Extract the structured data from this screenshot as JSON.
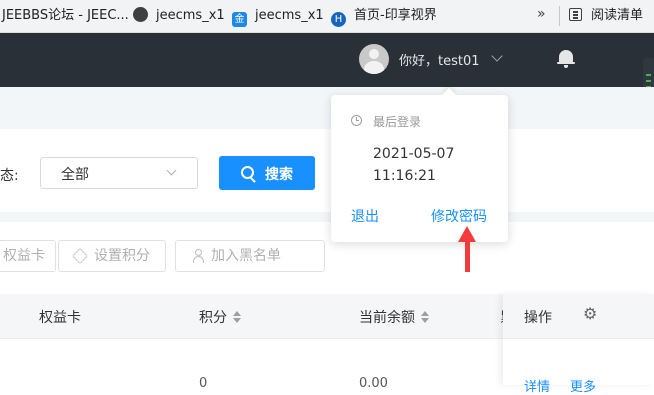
{
  "bookmarks": {
    "items": [
      {
        "label": "JEEBBS论坛 - JEEC..."
      },
      {
        "label": "jeecms_x1",
        "icon": "globe-icon"
      },
      {
        "label": "jeecms_x1",
        "icon": "jin-icon"
      },
      {
        "label": "首页-印享视界",
        "icon": "h-icon"
      }
    ],
    "overflow": "»",
    "reading_list": "阅读清单"
  },
  "header": {
    "greeting": "你好，test01"
  },
  "popover": {
    "title": "最后登录",
    "date": "2021-05-07",
    "time": "11:16:21",
    "logout": "退出",
    "change_password": "修改密码"
  },
  "filter": {
    "label": "态:",
    "status_value": "全部",
    "search_label": "搜索"
  },
  "actions": {
    "benefit_card": "权益卡",
    "set_points": "设置积分",
    "blacklist": "加入黑名单"
  },
  "table": {
    "columns": {
      "benefit_card": "权益卡",
      "points": "积分",
      "balance": "当前余额",
      "cut": "累",
      "ops": "操作"
    },
    "row": {
      "points": "0",
      "balance": "0.00",
      "details": "详情",
      "more": "更多"
    }
  },
  "colors": {
    "primary": "#1890ff",
    "header_bg": "#2a3038",
    "annotation": "#f23c3c"
  }
}
